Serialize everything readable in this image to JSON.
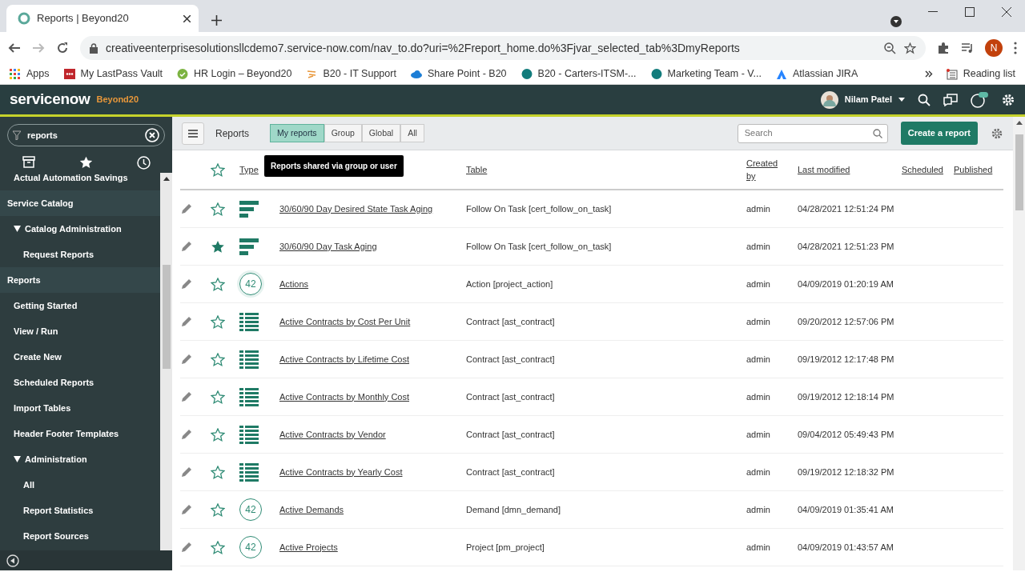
{
  "browser": {
    "tab_title": "Reports | Beyond20",
    "url": "creativeenterprisesolutionsllcdemo7.service-now.com/nav_to.do?uri=%2Freport_home.do%3Fjvar_selected_tab%3DmyReports",
    "profile_initial": "N",
    "bookmarks": [
      "Apps",
      "My LastPass Vault",
      "HR Login – Beyond20",
      "B20 - IT Support",
      "Share Point - B20",
      "B20 - Carters-ITSM-...",
      "Marketing Team - V...",
      "Atlassian JIRA"
    ],
    "reading_list": "Reading list"
  },
  "header": {
    "logo": "servicenow",
    "instance": "Beyond20",
    "user": "Nilam Patel"
  },
  "sidebar": {
    "filter": "reports",
    "items": [
      {
        "label": "Actual Automation Savings",
        "kind": "item"
      },
      {
        "label": "Service Catalog",
        "kind": "section"
      },
      {
        "label": "Catalog Administration",
        "kind": "folder",
        "expanded": true,
        "children": [
          {
            "label": "Request Reports"
          }
        ]
      },
      {
        "label": "Reports",
        "kind": "section"
      },
      {
        "label": "Getting Started",
        "kind": "item"
      },
      {
        "label": "View / Run",
        "kind": "item"
      },
      {
        "label": "Create New",
        "kind": "item"
      },
      {
        "label": "Scheduled Reports",
        "kind": "item"
      },
      {
        "label": "Import Tables",
        "kind": "item"
      },
      {
        "label": "Header Footer Templates",
        "kind": "item"
      },
      {
        "label": "Administration",
        "kind": "folder",
        "expanded": true,
        "children": [
          {
            "label": "All"
          },
          {
            "label": "Report Statistics"
          },
          {
            "label": "Report Sources"
          }
        ]
      }
    ]
  },
  "toolbar": {
    "title": "Reports",
    "tabs": [
      {
        "label": "My reports",
        "selected": true
      },
      {
        "label": "Group",
        "selected": false
      },
      {
        "label": "Global",
        "selected": false
      },
      {
        "label": "All",
        "selected": false
      }
    ],
    "tooltip": "Reports shared via group or user",
    "search": {
      "placeholder": "Search"
    },
    "create_button": "Create a report"
  },
  "table": {
    "columns": [
      "Type",
      "Table",
      "Created by",
      "Last modified",
      "Scheduled",
      "Published"
    ],
    "rows": [
      {
        "kind": "bar",
        "title": "30/60/90 Day Desired State Task Aging",
        "table": "Follow On Task [cert_follow_on_task]",
        "created_by": "admin",
        "last_modified": "04/28/2021 12:51:24 PM",
        "favorite": false
      },
      {
        "kind": "bar",
        "title": "30/60/90 Day Task Aging",
        "table": "Follow On Task [cert_follow_on_task]",
        "created_by": "admin",
        "last_modified": "04/28/2021 12:51:23 PM",
        "favorite": true
      },
      {
        "kind": "score",
        "score": "42",
        "title": "Actions",
        "table": "Action [project_action]",
        "created_by": "admin",
        "last_modified": "04/09/2019 01:20:19 AM",
        "favorite": false,
        "hovered": true
      },
      {
        "kind": "list",
        "title": "Active Contracts by Cost Per Unit",
        "table": "Contract [ast_contract]",
        "created_by": "admin",
        "last_modified": "09/20/2012 12:57:06 PM",
        "favorite": false
      },
      {
        "kind": "list",
        "title": "Active Contracts by Lifetime Cost",
        "table": "Contract [ast_contract]",
        "created_by": "admin",
        "last_modified": "09/19/2012 12:17:48 PM",
        "favorite": false
      },
      {
        "kind": "list",
        "title": "Active Contracts by Monthly Cost",
        "table": "Contract [ast_contract]",
        "created_by": "admin",
        "last_modified": "09/19/2012 12:18:14 PM",
        "favorite": false
      },
      {
        "kind": "list",
        "title": "Active Contracts by Vendor",
        "table": "Contract [ast_contract]",
        "created_by": "admin",
        "last_modified": "09/04/2012 05:49:43 PM",
        "favorite": false
      },
      {
        "kind": "list",
        "title": "Active Contracts by Yearly Cost",
        "table": "Contract [ast_contract]",
        "created_by": "admin",
        "last_modified": "09/19/2012 12:18:32 PM",
        "favorite": false
      },
      {
        "kind": "score",
        "score": "42",
        "title": "Active Demands",
        "table": "Demand [dmn_demand]",
        "created_by": "admin",
        "last_modified": "04/09/2019 01:35:41 AM",
        "favorite": false
      },
      {
        "kind": "score",
        "score": "42",
        "title": "Active Projects",
        "table": "Project [pm_project]",
        "created_by": "admin",
        "last_modified": "04/09/2019 01:43:57 AM",
        "favorite": false
      }
    ]
  }
}
